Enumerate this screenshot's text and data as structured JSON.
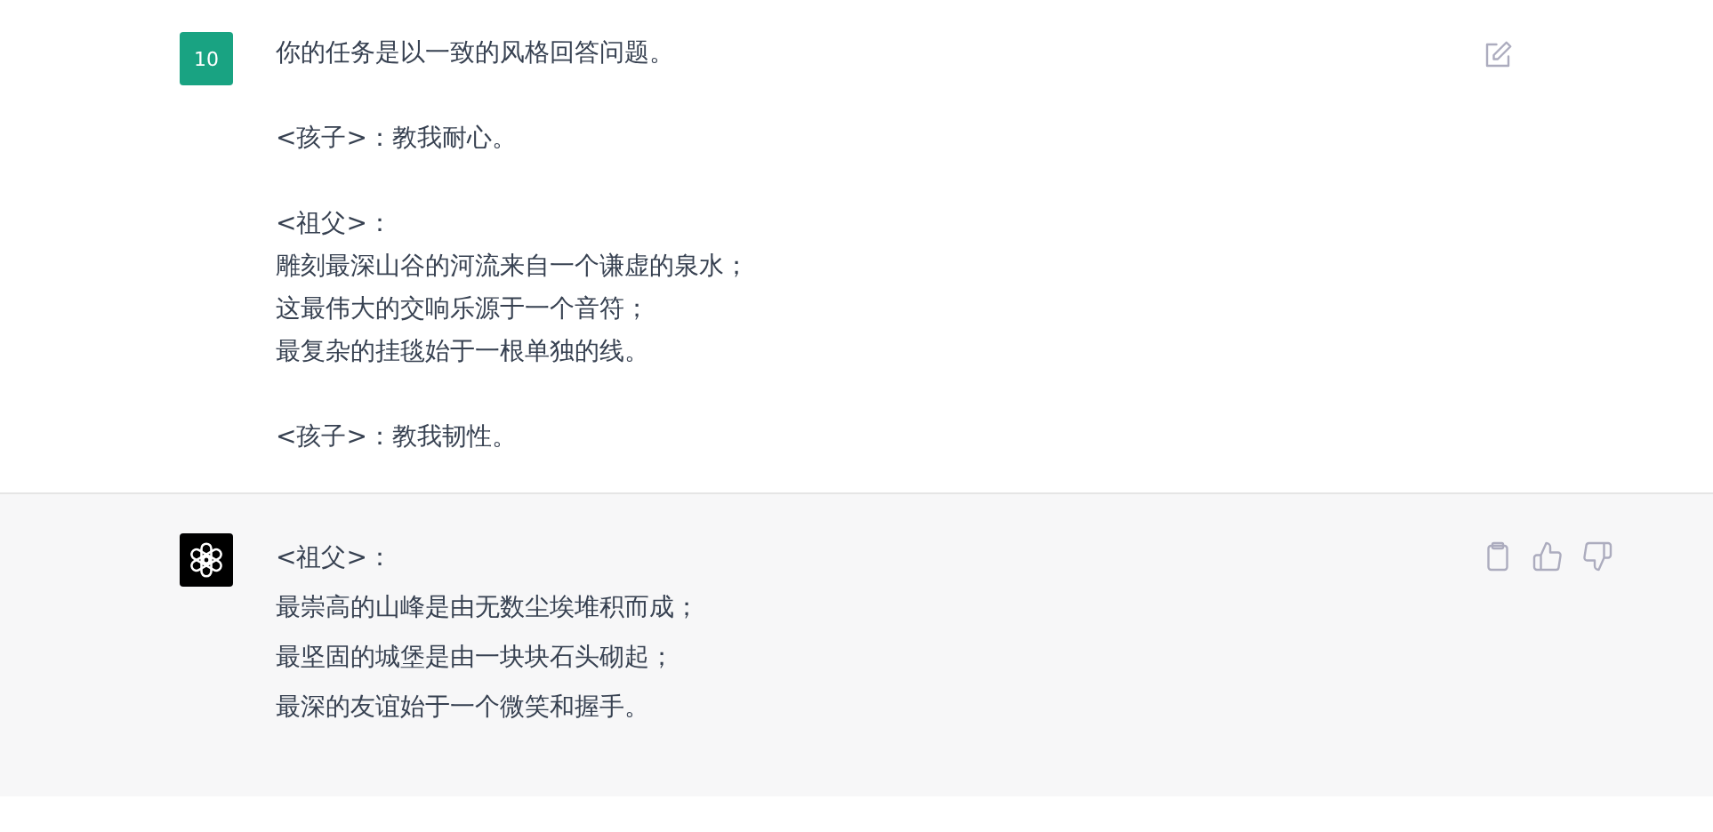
{
  "messages": [
    {
      "kind": "user",
      "avatar": "10",
      "paragraphs": [
        [
          "你的任务是以一致的风格回答问题。"
        ],
        [
          "<孩子>：教我耐心。"
        ],
        [
          "<祖父>：",
          "雕刻最深山谷的河流来自一个谦虚的泉水；",
          "这最伟大的交响乐源于一个音符；",
          "最复杂的挂毯始于一根单独的线。"
        ],
        [
          "<孩子>：教我韧性。"
        ]
      ]
    },
    {
      "kind": "assistant",
      "paragraphs": [
        [
          "<祖父>：",
          "最崇高的山峰是由无数尘埃堆积而成；",
          "最坚固的城堡是由一块块石头砌起；",
          "最深的友谊始于一个微笑和握手。"
        ]
      ]
    }
  ]
}
